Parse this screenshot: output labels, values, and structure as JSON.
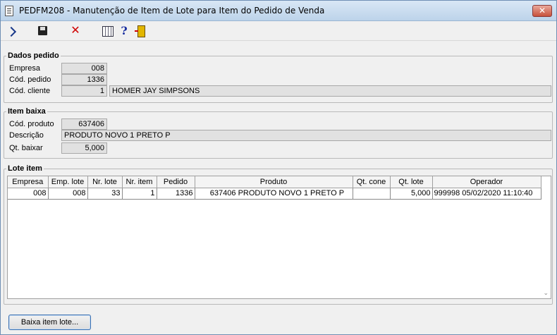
{
  "window": {
    "title": "PEDFM208 - Manutenção de Item de Lote para Item do Pedido de Venda",
    "close_label": "✕"
  },
  "toolbar": {
    "cancel_glyph": "✕",
    "help_glyph": "?"
  },
  "dados_pedido": {
    "legend": "Dados pedido",
    "empresa_label": "Empresa",
    "empresa_value": "008",
    "cod_pedido_label": "Cód. pedido",
    "cod_pedido_value": "1336",
    "cod_cliente_label": "Cód. cliente",
    "cod_cliente_value": "1",
    "cliente_nome": "HOMER JAY SIMPSONS"
  },
  "item_baixa": {
    "legend": "Item baixa",
    "cod_produto_label": "Cód. produto",
    "cod_produto_value": "637406",
    "descricao_label": "Descrição",
    "descricao_value": "PRODUTO NOVO 1 PRETO P",
    "qt_baixar_label": "Qt. baixar",
    "qt_baixar_value": "5,000"
  },
  "lote_item": {
    "legend": "Lote item",
    "columns": [
      "Empresa",
      "Emp. lote",
      "Nr. lote",
      "Nr. item",
      "Pedido",
      "Produto",
      "Qt. cone",
      "Qt. lote",
      "Operador"
    ],
    "row": {
      "empresa": "008",
      "emp_lote": "008",
      "nr_lote": "33",
      "nr_item": "1",
      "pedido": "1336",
      "produto_cod": "637406",
      "produto_desc": "PRODUTO NOVO 1 PRETO P",
      "qt_cone": "",
      "qt_lote": "5,000",
      "operador_id": "999998",
      "operador_data": "05/02/2020 11:10:40"
    }
  },
  "baixa_button": "Baixa item lote..."
}
